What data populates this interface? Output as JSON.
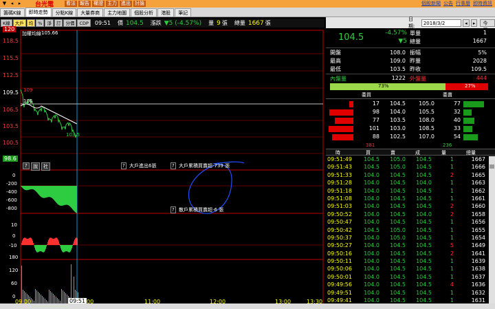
{
  "topbar": {
    "stock_name": "台光電",
    "menu": [
      "看法",
      "報告",
      "權證",
      "主力",
      "進出",
      "討論"
    ],
    "links": [
      "個股新聞",
      "公告",
      "行事曆",
      "即時資訊"
    ]
  },
  "tabs": [
    "籌碼K線",
    "即時走勢",
    "分點K線",
    "大量券商",
    "主力地圖",
    "個股分析",
    "港股",
    "筆記"
  ],
  "toolbar": {
    "buttons": [
      "K線",
      "大戶",
      "均",
      "%",
      "淨",
      "訂",
      "分價",
      "CDP"
    ],
    "time": "09:51",
    "price_label": "價",
    "price_value": "104.5",
    "change_label": "漲跌",
    "change_value": "▼5 (-4.57%)",
    "vol_label": "量",
    "vol_value": "9",
    "vol_unit": "張",
    "total_label": "總量",
    "total_value": "1667",
    "total_unit": "張"
  },
  "chart": {
    "avg_label": "加權均線",
    "avg_value": "105.66",
    "price_ticks": [
      "120",
      "118.5",
      "115.5",
      "112.5",
      "109.5",
      "106.5",
      "103.5",
      "100.5",
      "98.6"
    ],
    "open_mark": "109",
    "avg_mark": "106",
    "low_mark": "103.5",
    "sub1_buttons": [
      "?",
      "說",
      "社"
    ],
    "sub1_ticks": [
      "0",
      "-200",
      "-400",
      "-600",
      "-800"
    ],
    "sub1_note1": "大戶進出6張",
    "sub1_note2": "大戶累積買賣超-739 張",
    "sub2_note": "散戶累積買賣超-6 張",
    "sub2_ticks": [
      "10",
      "0",
      "-10"
    ],
    "sub3_ticks": [
      "180",
      "120",
      "60",
      "0"
    ],
    "time_labels": [
      "09:00",
      "00",
      "11:00",
      "12:00",
      "13:00",
      "13:30"
    ],
    "cursor_time": "09:51",
    "colors": {
      "up": "#ff3030",
      "down": "#2ecc40",
      "grid": "#c00000",
      "avg": "#ffffff",
      "cursor": "#00c8ff",
      "volume": "#e08a00"
    }
  },
  "right": {
    "date_label": "日期:",
    "date_value": "2018/3/2",
    "today_label": "今天",
    "price": "104.5",
    "pct": "-4.57%",
    "change": "▼5",
    "single_label": "單量",
    "single_value": "1",
    "total_label": "總量",
    "total_value": "1667",
    "stats": [
      {
        "l": "開盤",
        "v": "108.0",
        "l2": "振幅",
        "v2": "5%"
      },
      {
        "l": "最高",
        "v": "109.0",
        "l2": "昨量",
        "v2": "2028"
      },
      {
        "l": "最低",
        "v": "103.5",
        "l2": "昨收",
        "v2": "109.5"
      }
    ],
    "inner_label": "內盤量",
    "inner_value": "1222",
    "outer_label": "外盤量",
    "outer_value": "444",
    "inner_pct": "73%",
    "outer_pct": "27%",
    "inner_frac": 0.73,
    "buy_label": "委買",
    "sell_label": "委賣",
    "book": [
      {
        "bq": "17",
        "bp": "104.5",
        "sp": "105.0",
        "sq": "77"
      },
      {
        "bq": "98",
        "bp": "104.0",
        "sp": "105.5",
        "sq": "32"
      },
      {
        "bq": "77",
        "bp": "103.5",
        "sp": "108.0",
        "sq": "40"
      },
      {
        "bq": "101",
        "bp": "103.0",
        "sp": "108.5",
        "sq": "33"
      },
      {
        "bq": "88",
        "bp": "102.5",
        "sp": "107.0",
        "sq": "54"
      }
    ],
    "buy_total": "381",
    "sell_total": "236",
    "tick_headers": [
      "時",
      "買",
      "賣",
      "成",
      "量",
      "總量"
    ],
    "ticks": [
      [
        "09:51:49",
        "104.5",
        "105.0",
        "104.5",
        "1",
        "1667"
      ],
      [
        "09:51:43",
        "104.5",
        "105.0",
        "104.5",
        "1",
        "1666"
      ],
      [
        "09:51:33",
        "104.0",
        "104.5",
        "104.5",
        "2",
        "1665"
      ],
      [
        "09:51:28",
        "104.0",
        "104.5",
        "104.0",
        "1",
        "1663"
      ],
      [
        "09:51:18",
        "104.0",
        "104.5",
        "104.5",
        "1",
        "1662"
      ],
      [
        "09:51:08",
        "104.0",
        "104.5",
        "104.5",
        "1",
        "1661"
      ],
      [
        "09:51:03",
        "104.0",
        "104.5",
        "104.5",
        "2",
        "1660"
      ],
      [
        "09:50:52",
        "104.0",
        "104.5",
        "104.0",
        "2",
        "1658"
      ],
      [
        "09:50:47",
        "104.0",
        "104.5",
        "104.5",
        "1",
        "1656"
      ],
      [
        "09:50:42",
        "104.5",
        "105.0",
        "104.5",
        "1",
        "1655"
      ],
      [
        "09:50:37",
        "104.0",
        "105.0",
        "104.5",
        "1",
        "1654"
      ],
      [
        "09:50:27",
        "104.0",
        "104.5",
        "104.5",
        "5",
        "1649"
      ],
      [
        "09:50:16",
        "104.0",
        "104.5",
        "104.5",
        "2",
        "1641"
      ],
      [
        "09:50:11",
        "104.0",
        "104.5",
        "104.5",
        "1",
        "1639"
      ],
      [
        "09:50:06",
        "104.0",
        "104.5",
        "104.5",
        "1",
        "1638"
      ],
      [
        "09:50:01",
        "104.0",
        "104.5",
        "104.5",
        "1",
        "1637"
      ],
      [
        "09:49:56",
        "104.0",
        "104.5",
        "104.5",
        "4",
        "1636"
      ],
      [
        "09:49:51",
        "104.0",
        "104.5",
        "104.5",
        "1",
        "1632"
      ],
      [
        "09:49:41",
        "104.0",
        "104.5",
        "104.5",
        "1",
        "1631"
      ]
    ]
  }
}
